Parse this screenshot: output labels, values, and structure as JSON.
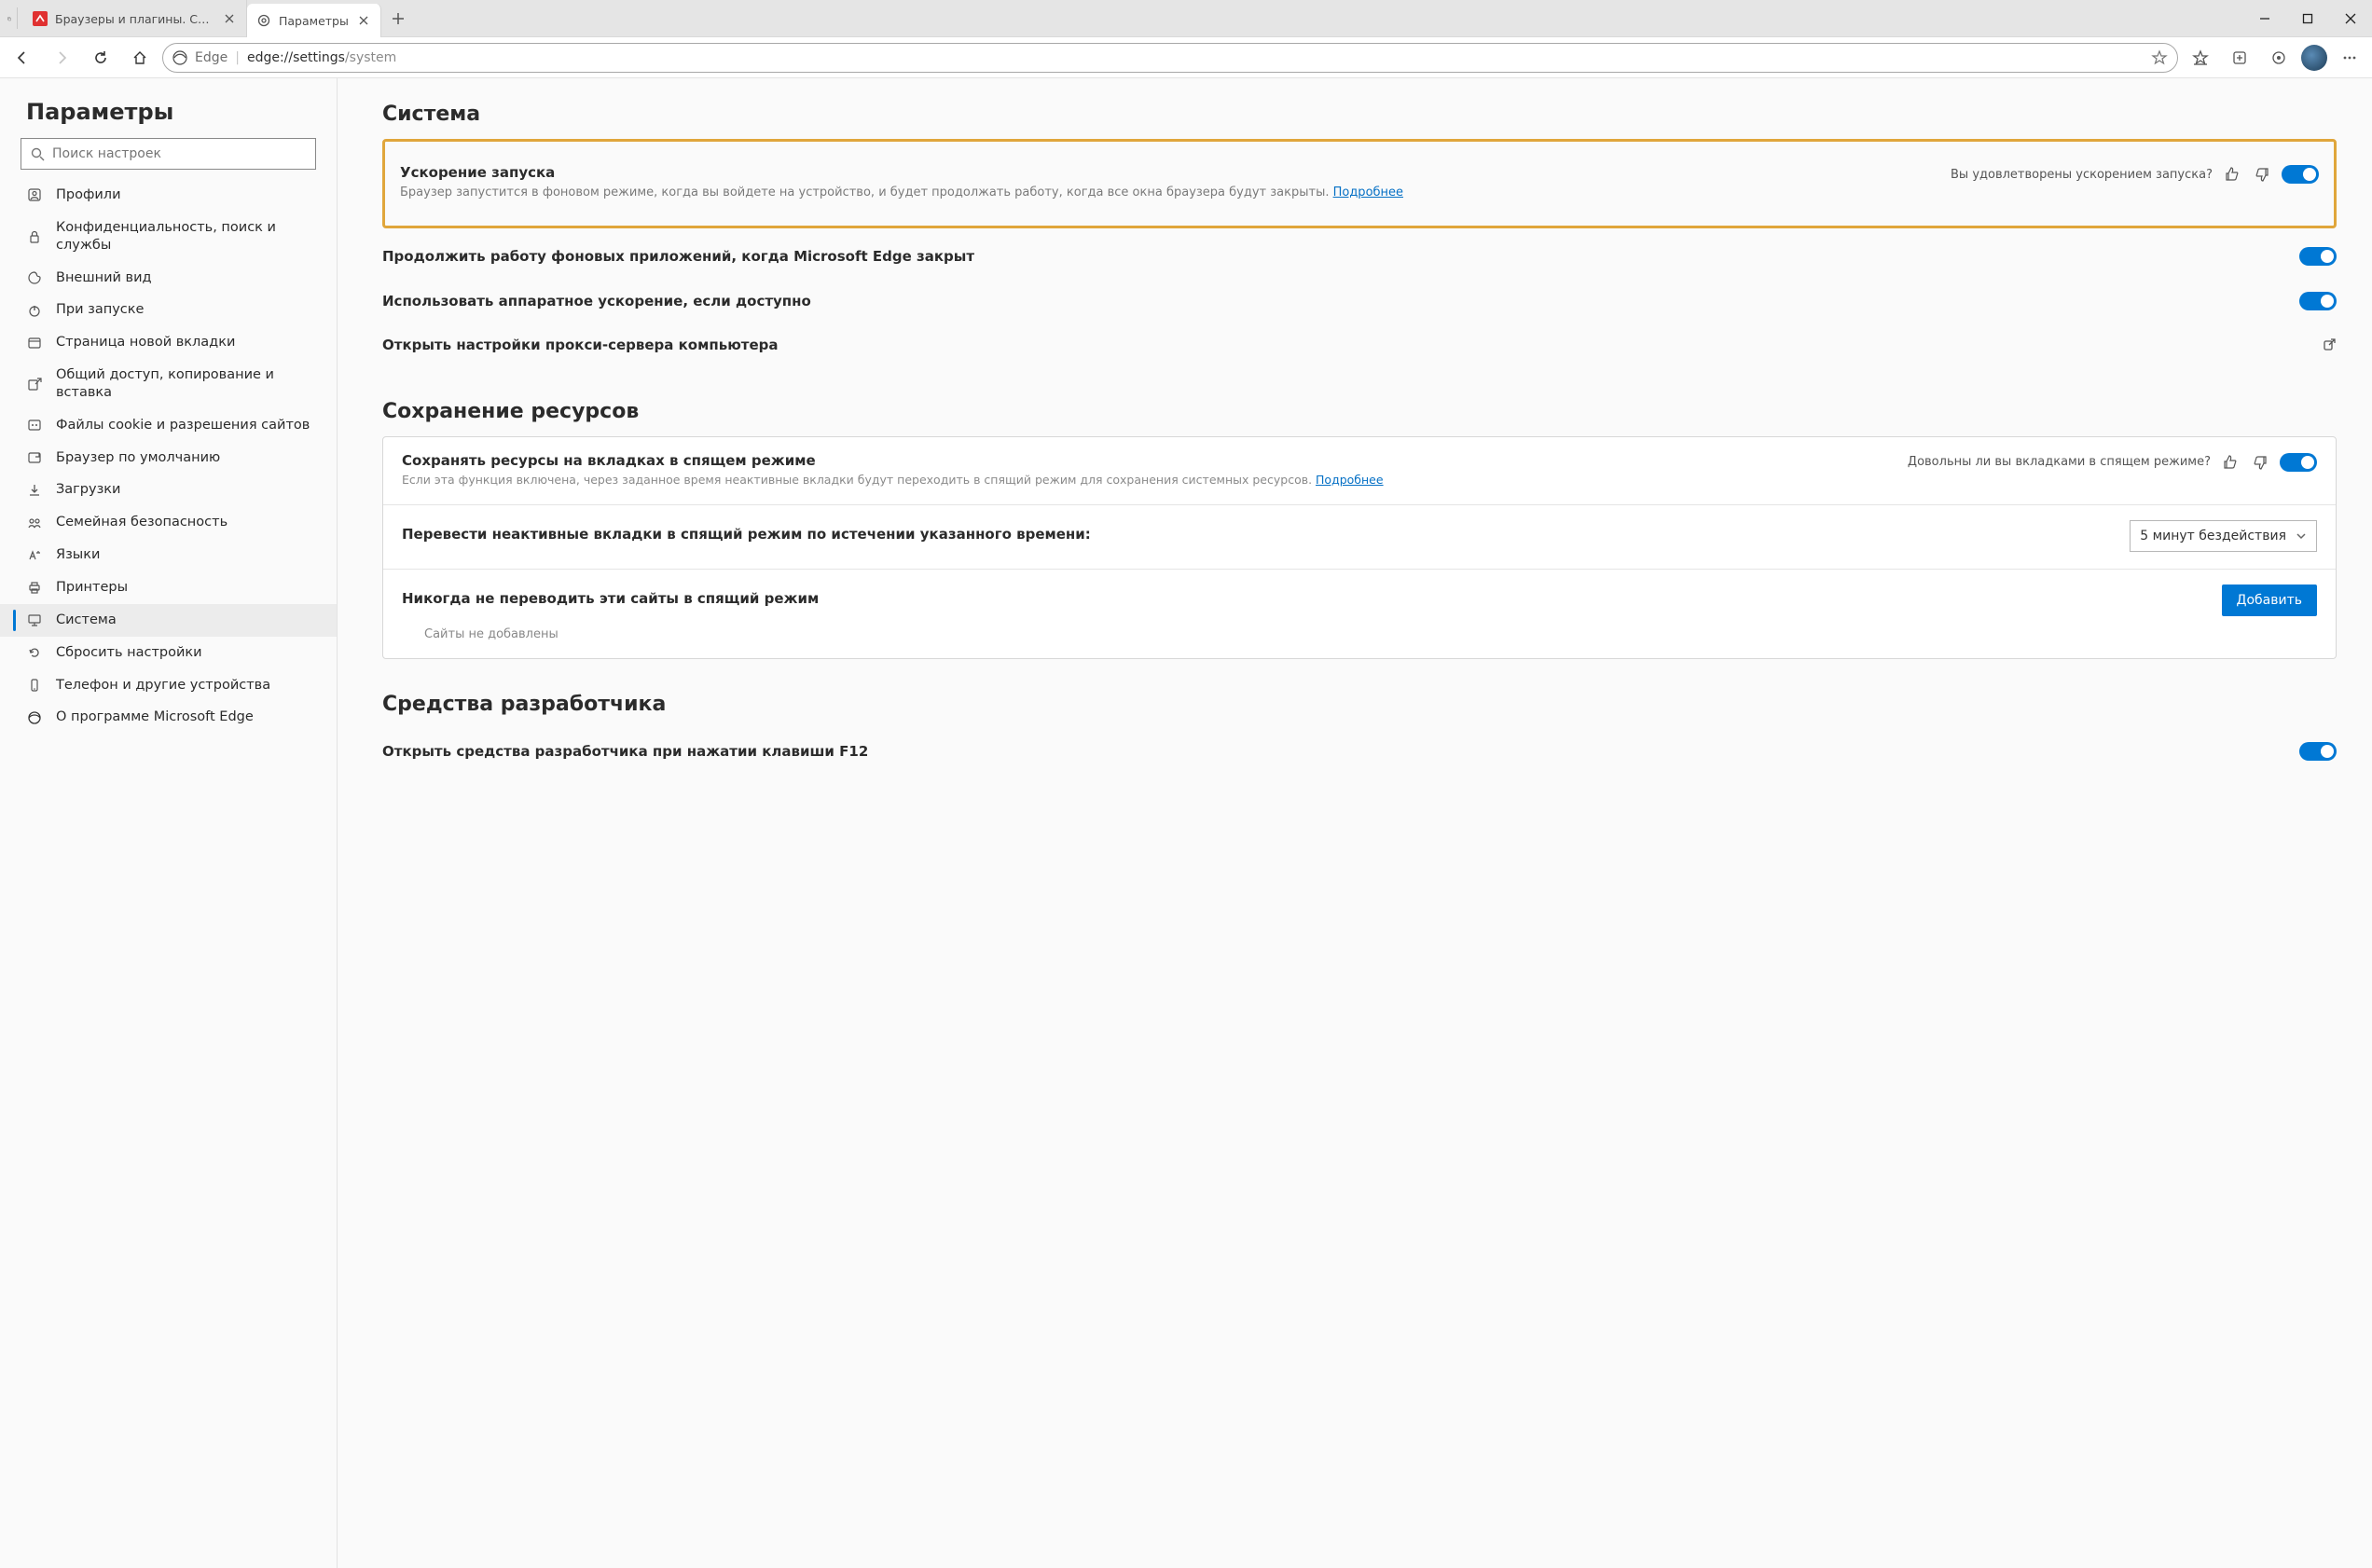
{
  "tabs": [
    {
      "label": "Браузеры и плагины. Скачать б"
    },
    {
      "label": "Параметры"
    }
  ],
  "omnibox": {
    "edge_label": "Edge",
    "url_prefix": "edge://settings",
    "url_suffix": "/system"
  },
  "sidebar": {
    "heading": "Параметры",
    "search_placeholder": "Поиск настроек",
    "items": [
      {
        "label": "Профили"
      },
      {
        "label": "Конфиденциальность, поиск и службы"
      },
      {
        "label": "Внешний вид"
      },
      {
        "label": "При запуске"
      },
      {
        "label": "Страница новой вкладки"
      },
      {
        "label": "Общий доступ, копирование и вставка"
      },
      {
        "label": "Файлы cookie и разрешения сайтов"
      },
      {
        "label": "Браузер по умолчанию"
      },
      {
        "label": "Загрузки"
      },
      {
        "label": "Семейная безопасность"
      },
      {
        "label": "Языки"
      },
      {
        "label": "Принтеры"
      },
      {
        "label": "Система"
      },
      {
        "label": "Сбросить настройки"
      },
      {
        "label": "Телефон и другие устройства"
      },
      {
        "label": "О программе Microsoft Edge"
      }
    ]
  },
  "system": {
    "heading": "Система",
    "boost": {
      "title": "Ускорение запуска",
      "desc_pre": "Браузер запустится в фоновом режиме, когда вы войдете на устройство, и будет продолжать работу, когда все окна браузера будут закрыты. ",
      "learn_more": "Подробнее",
      "feedback_q": "Вы удовлетворены ускорением запуска?"
    },
    "bg_apps": "Продолжить работу фоновых приложений, когда Microsoft Edge закрыт",
    "hw_accel": "Использовать аппаратное ускорение, если доступно",
    "proxy": "Открыть настройки прокси-сервера компьютера"
  },
  "resources": {
    "heading": "Сохранение ресурсов",
    "sleep": {
      "title": "Сохранять ресурсы на вкладках в спящем режиме",
      "desc_pre": "Если эта функция включена, через заданное время неактивные вкладки будут переходить в спящий режим для сохранения системных ресурсов. ",
      "learn_more": "Подробнее",
      "feedback_q": "Довольны ли вы вкладками в спящем режиме?"
    },
    "timeout_label": "Перевести неактивные вкладки в спящий режим по истечении указанного времени:",
    "timeout_value": "5 минут бездействия",
    "never_label": "Никогда не переводить эти сайты в спящий режим",
    "add_button": "Добавить",
    "no_sites": "Сайты не добавлены"
  },
  "devtools": {
    "heading": "Средства разработчика",
    "f12": "Открыть средства разработчика при нажатии клавиши F12"
  }
}
